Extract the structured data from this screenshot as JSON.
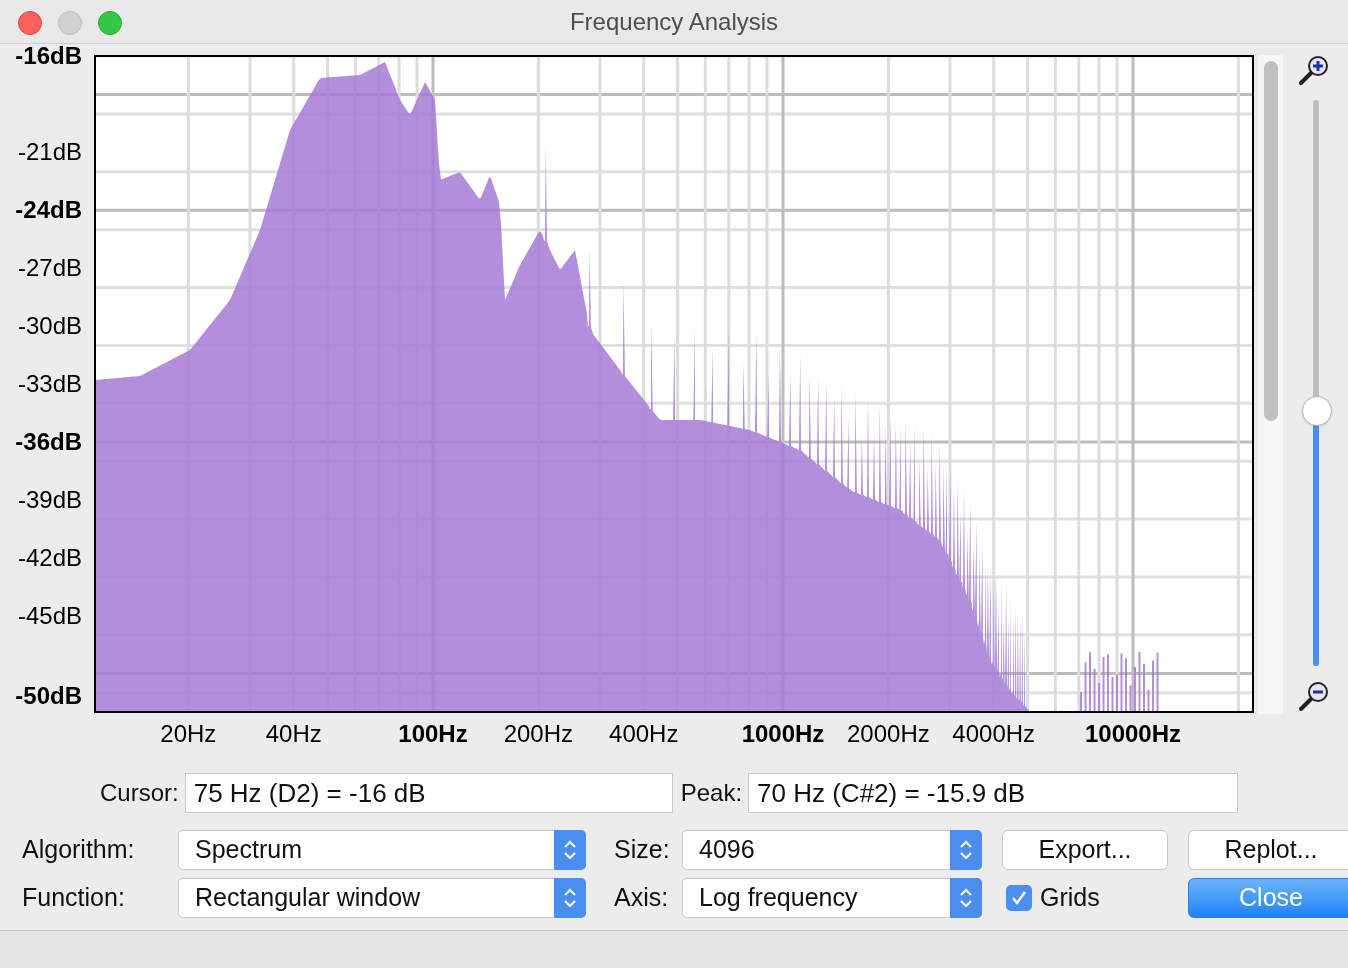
{
  "window": {
    "title": "Frequency Analysis"
  },
  "plot": {
    "y_labels": [
      {
        "text": "-16dB",
        "major": true
      },
      {
        "text": "-21dB",
        "major": false
      },
      {
        "text": "-24dB",
        "major": true
      },
      {
        "text": "-27dB",
        "major": false
      },
      {
        "text": "-30dB",
        "major": false
      },
      {
        "text": "-33dB",
        "major": false
      },
      {
        "text": "-36dB",
        "major": true
      },
      {
        "text": "-39dB",
        "major": false
      },
      {
        "text": "-42dB",
        "major": false
      },
      {
        "text": "-45dB",
        "major": false
      },
      {
        "text": "-50dB",
        "major": true
      }
    ],
    "x_labels": [
      {
        "text": "20Hz",
        "major": false
      },
      {
        "text": "40Hz",
        "major": false
      },
      {
        "text": "100Hz",
        "major": true
      },
      {
        "text": "200Hz",
        "major": false
      },
      {
        "text": "400Hz",
        "major": false
      },
      {
        "text": "1000Hz",
        "major": true
      },
      {
        "text": "2000Hz",
        "major": false
      },
      {
        "text": "4000Hz",
        "major": false
      },
      {
        "text": "10000Hz",
        "major": true
      }
    ]
  },
  "zoom_slider": {
    "level": 0.45
  },
  "cursor": {
    "label": "Cursor:",
    "value": "75 Hz (D2) = -16 dB"
  },
  "peak": {
    "label": "Peak:",
    "value": "70 Hz (C#2) = -15.9 dB"
  },
  "algorithm": {
    "label": "Algorithm:",
    "value": "Spectrum"
  },
  "size": {
    "label": "Size:",
    "value": "4096"
  },
  "function": {
    "label": "Function:",
    "value": "Rectangular window"
  },
  "axis": {
    "label": "Axis:",
    "value": "Log frequency"
  },
  "grids": {
    "label": "Grids",
    "checked": true
  },
  "buttons": [
    {
      "label": "Export...",
      "default": false
    },
    {
      "label": "Replot...",
      "default": false
    },
    {
      "label": "Close",
      "default": true
    }
  ]
}
